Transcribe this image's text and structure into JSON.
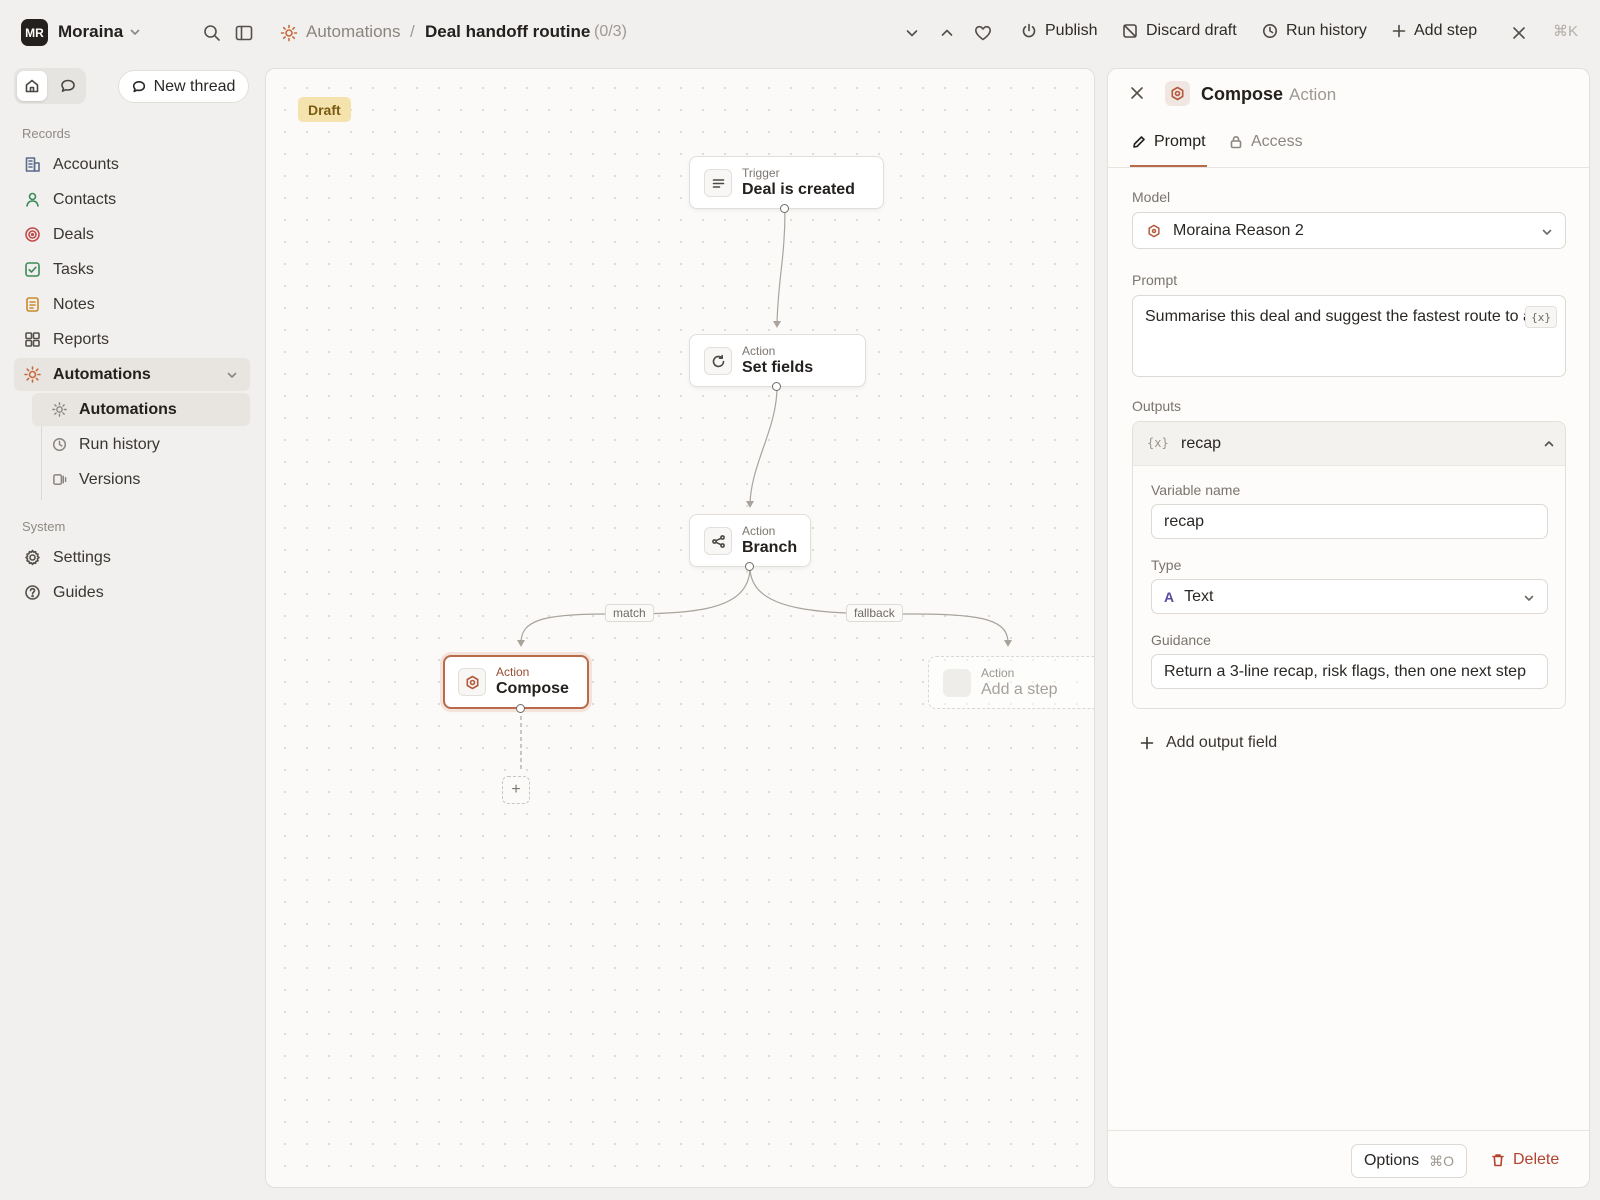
{
  "workspace": {
    "initials": "MR",
    "name": "Moraina"
  },
  "breadcrumb": {
    "parent": "Automations",
    "separator": "/",
    "current": "Deal handoff routine",
    "count": "(0/3)"
  },
  "toolbar": {
    "publish": "Publish",
    "discard": "Discard draft",
    "run_history": "Run history",
    "add_step": "Add step",
    "shortcut": "⌘K"
  },
  "sidebar": {
    "new_thread": "New thread",
    "records_title": "Records",
    "records": [
      {
        "label": "Accounts",
        "icon": "building-icon",
        "color": "#5b6b8c"
      },
      {
        "label": "Contacts",
        "icon": "person-icon",
        "color": "#3d8a5a"
      },
      {
        "label": "Deals",
        "icon": "target-icon",
        "color": "#c24a4a"
      },
      {
        "label": "Tasks",
        "icon": "checkbox-icon",
        "color": "#3d8a5a"
      },
      {
        "label": "Notes",
        "icon": "note-icon",
        "color": "#c98a2b"
      },
      {
        "label": "Reports",
        "icon": "grid-icon",
        "color": "#55504a"
      }
    ],
    "automations_group": {
      "label": "Automations",
      "icon": "sun-icon",
      "color": "#c46a3c"
    },
    "automations_sub": [
      {
        "label": "Automations",
        "icon": "sun-icon"
      },
      {
        "label": "Run history",
        "icon": "clock-icon"
      },
      {
        "label": "Versions",
        "icon": "versions-icon"
      }
    ],
    "system_title": "System",
    "system": [
      {
        "label": "Settings",
        "icon": "gear-icon"
      },
      {
        "label": "Guides",
        "icon": "help-icon"
      }
    ]
  },
  "canvas": {
    "status_badge": "Draft",
    "nodes": {
      "trigger": {
        "label": "Trigger",
        "title": "Deal is created"
      },
      "set_fields": {
        "label": "Action",
        "title": "Set fields"
      },
      "branch": {
        "label": "Action",
        "title": "Branch"
      },
      "compose": {
        "label": "Action",
        "title": "Compose"
      },
      "placeholder": {
        "label": "Action",
        "title": "Add a step"
      }
    },
    "edge_labels": {
      "match": "match",
      "fallback": "fallback"
    },
    "add_symbol": "+"
  },
  "panel": {
    "title": "Compose",
    "subtitle": "Action",
    "tabs": {
      "prompt": "Prompt",
      "access": "Access"
    },
    "model_label": "Model",
    "model_value": "Moraina Reason 2",
    "prompt_label": "Prompt",
    "prompt_value": "Summarise this deal and suggest the fastest route to a",
    "variable_chip": "{x}",
    "outputs_label": "Outputs",
    "output": {
      "name": "recap",
      "variable_name_label": "Variable name",
      "variable_name_value": "recap",
      "type_label": "Type",
      "type_glyph": "A",
      "type_value": "Text",
      "guidance_label": "Guidance",
      "guidance_value": "Return a 3-line recap, risk flags, then one next step"
    },
    "add_output": "Add output field",
    "options": "Options",
    "options_shortcut": "⌘O",
    "delete": "Delete"
  }
}
